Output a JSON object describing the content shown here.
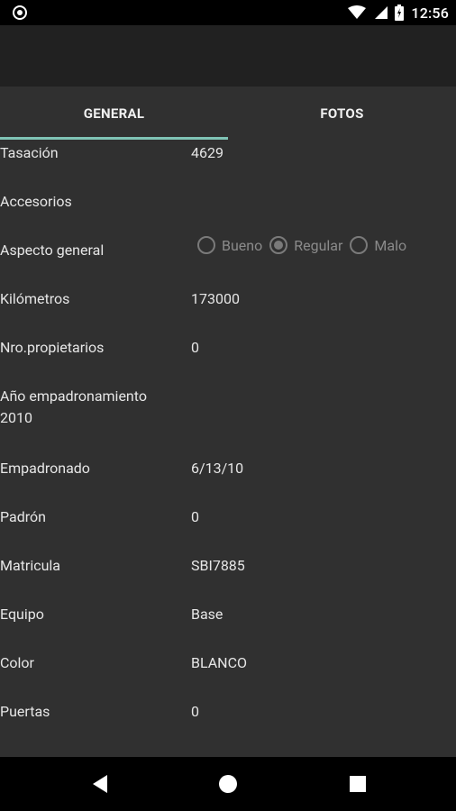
{
  "status_bar": {
    "time": "12:56",
    "icons": [
      "notification-circle-icon",
      "wifi-icon",
      "signal-icon",
      "battery-icon"
    ]
  },
  "tabs": [
    {
      "label": "GENERAL",
      "active": true
    },
    {
      "label": "FOTOS",
      "active": false
    }
  ],
  "fields": [
    {
      "label": "Tasación",
      "value": "4629"
    },
    {
      "label": "Accesorios",
      "value": ""
    },
    {
      "label": "Aspecto general",
      "value": ""
    },
    {
      "label": "Kilómetros",
      "value": "173000"
    },
    {
      "label": "Nro.propietarios",
      "value": "0"
    },
    {
      "label_line1": "Año empadronamiento",
      "label_line2": "2010"
    },
    {
      "label": "Empadronado",
      "value": "6/13/10"
    },
    {
      "label": "Padrón",
      "value": "0"
    },
    {
      "label": "Matricula",
      "value": "SBI7885"
    },
    {
      "label": "Equipo",
      "value": "Base"
    },
    {
      "label": "Color",
      "value": "BLANCO"
    },
    {
      "label": "Puertas",
      "value": "0"
    }
  ],
  "aspecto_options": [
    {
      "label": "Bueno",
      "selected": false
    },
    {
      "label": "Regular",
      "selected": true
    },
    {
      "label": "Malo",
      "selected": false
    }
  ],
  "colors": {
    "background": "#303030",
    "app_bar": "#212121",
    "tab_indicator": "#7fc3b5",
    "status_bar": "#000000"
  }
}
